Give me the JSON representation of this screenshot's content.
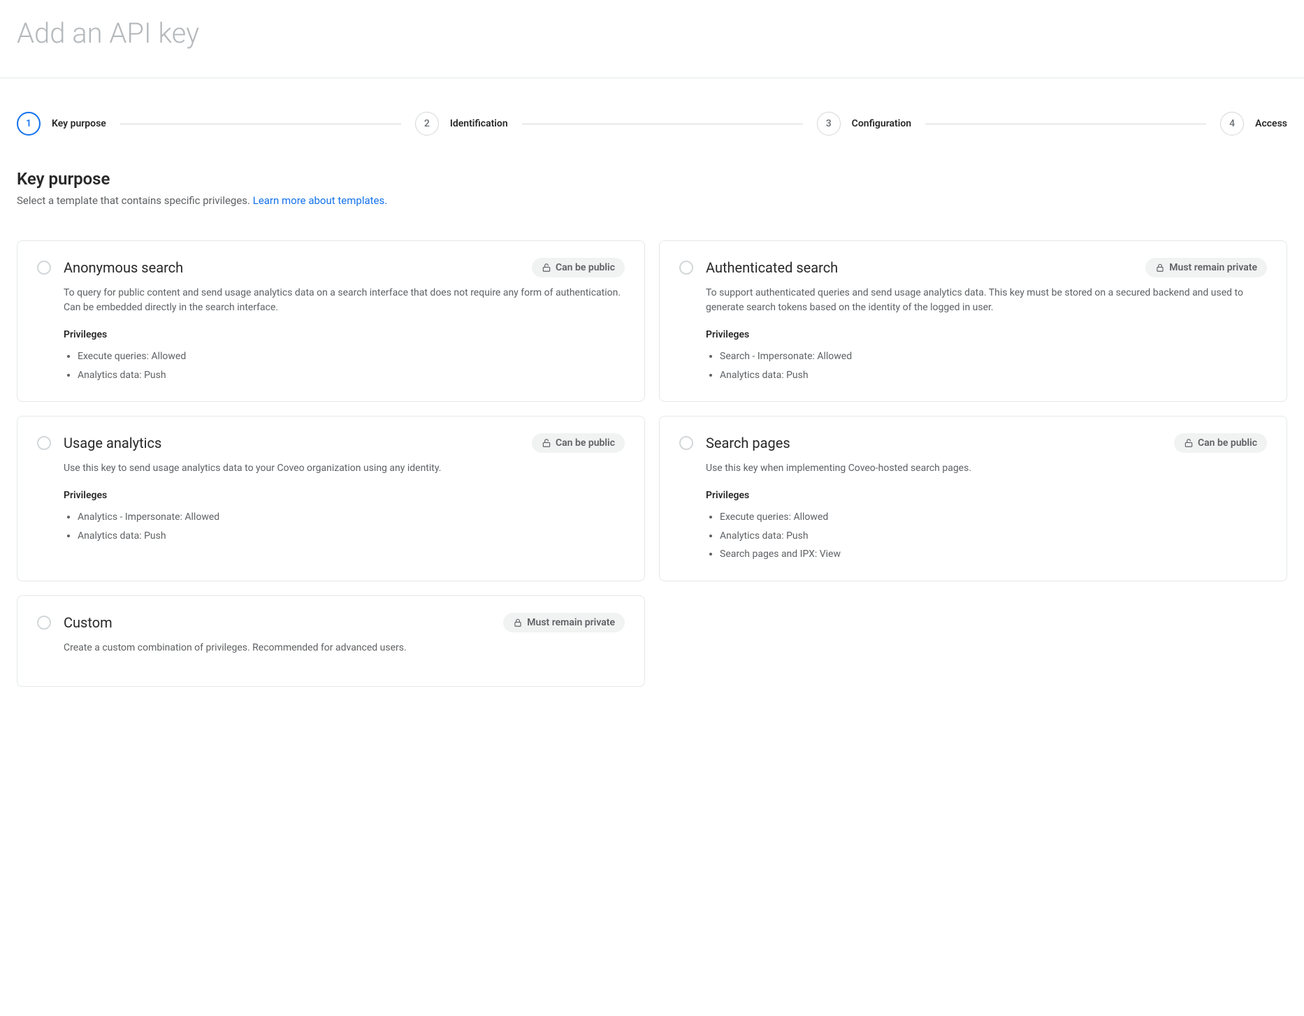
{
  "header": {
    "title": "Add an API key"
  },
  "stepper": {
    "steps": [
      {
        "num": "1",
        "label": "Key purpose",
        "active": true
      },
      {
        "num": "2",
        "label": "Identification",
        "active": false
      },
      {
        "num": "3",
        "label": "Configuration",
        "active": false
      },
      {
        "num": "4",
        "label": "Access",
        "active": false
      }
    ]
  },
  "section": {
    "title": "Key purpose",
    "desc_text": "Select a template that contains specific privileges. ",
    "desc_link": "Learn more about templates."
  },
  "privileges_label": "Privileges",
  "badges": {
    "public": "Can be public",
    "private": "Must remain private"
  },
  "cards": [
    {
      "id": "anonymous-search",
      "title": "Anonymous search",
      "badge_type": "public",
      "desc": "To query for public content and send usage analytics data on a search interface that does not require any form of authentication. Can be embedded directly in the search interface.",
      "privs": [
        "Execute queries: Allowed",
        "Analytics data: Push"
      ]
    },
    {
      "id": "authenticated-search",
      "title": "Authenticated search",
      "badge_type": "private",
      "desc": "To support authenticated queries and send usage analytics data. This key must be stored on a secured backend and used to generate search tokens based on the identity of the logged in user.",
      "privs": [
        "Search - Impersonate: Allowed",
        "Analytics data: Push"
      ]
    },
    {
      "id": "usage-analytics",
      "title": "Usage analytics",
      "badge_type": "public",
      "desc": "Use this key to send usage analytics data to your Coveo organization using any identity.",
      "privs": [
        "Analytics - Impersonate: Allowed",
        "Analytics data: Push"
      ]
    },
    {
      "id": "search-pages",
      "title": "Search pages",
      "badge_type": "public",
      "desc": "Use this key when implementing Coveo-hosted search pages.",
      "privs": [
        "Execute queries: Allowed",
        "Analytics data: Push",
        "Search pages and IPX: View"
      ]
    },
    {
      "id": "custom",
      "title": "Custom",
      "badge_type": "private",
      "desc": "Create a custom combination of privileges. Recommended for advanced users.",
      "privs": []
    }
  ]
}
